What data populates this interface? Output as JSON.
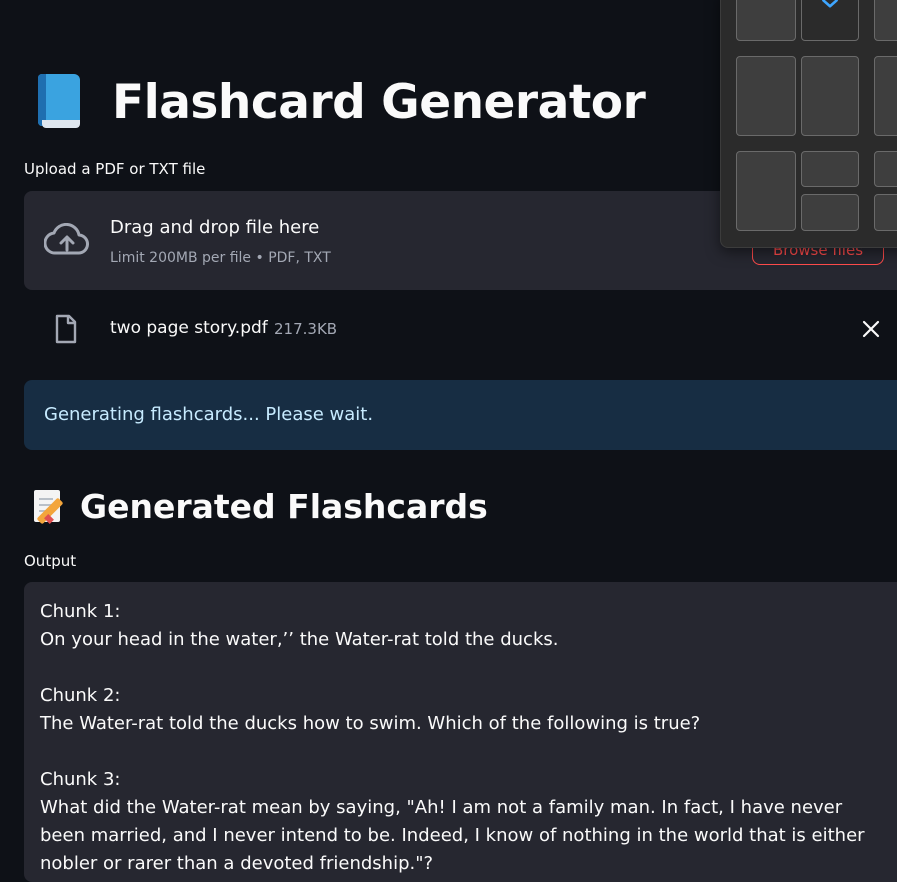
{
  "header": {
    "title": "Flashcard Generator",
    "icon": "book-icon"
  },
  "uploader": {
    "label": "Upload a PDF or TXT file",
    "drop_title": "Drag and drop file here",
    "drop_limit": "Limit 200MB per file • PDF, TXT",
    "browse_label": "Browse files",
    "accent": "#ff4b4b"
  },
  "file": {
    "name": "two page story.pdf",
    "size": "217.3KB"
  },
  "status": {
    "message": "Generating flashcards... Please wait.",
    "color": "#172d43"
  },
  "section": {
    "title": "Generated Flashcards",
    "icon": "memo-icon"
  },
  "output": {
    "label": "Output",
    "text": "Chunk 1:\nOn your head in the water,’’ the Water-rat told the ducks.\n\nChunk 2:\nThe Water-rat told the ducks how to swim. Which of the following is true?\n\nChunk 3:\nWhat did the Water-rat mean by saying, \"Ah! I am not a family man. In fact, I have never been married, and I never intend to be. Indeed, I know of nothing in the world that is either nobler or rarer than a devoted friendship.\"?"
  },
  "snap_layouts": {
    "icon": "vscode-icon"
  },
  "colors": {
    "background": "#0e1117",
    "surface": "#262730",
    "text": "#fafafa",
    "muted": "#a3a8b4"
  }
}
